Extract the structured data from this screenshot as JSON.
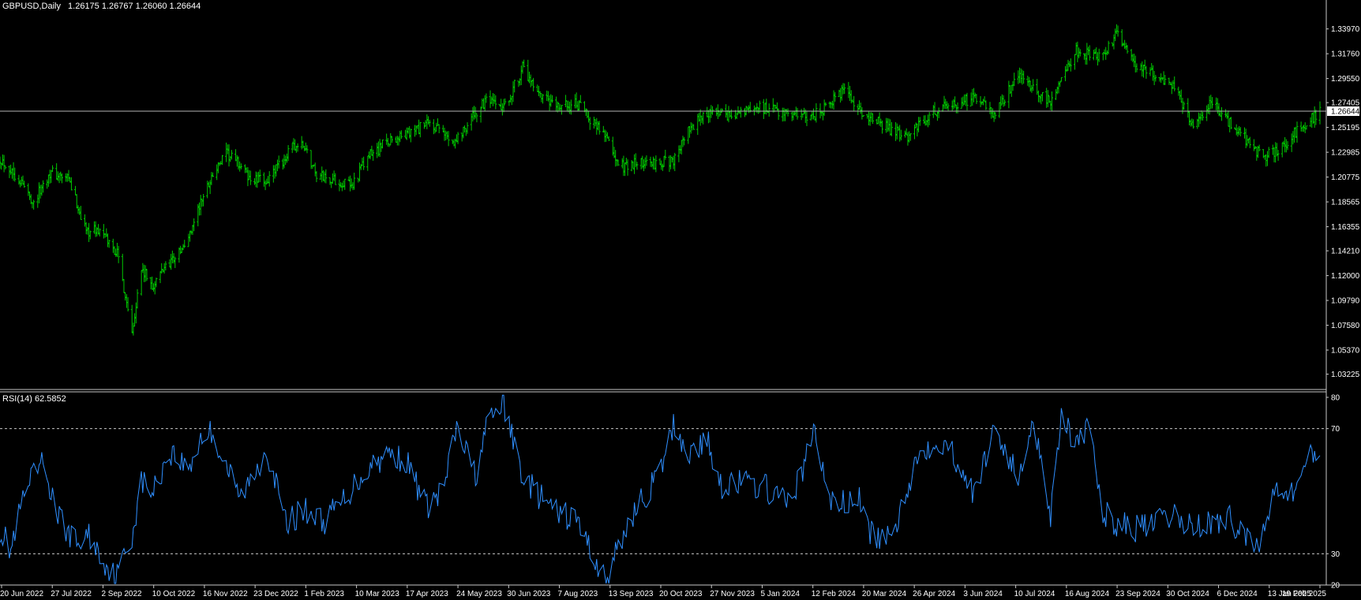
{
  "colors": {
    "background": "#000000",
    "text": "#ffffff",
    "axis": "#c8c8c8",
    "candle": "#00c800",
    "rsi": "#2f8fff",
    "level_line": "#c8c8c8",
    "current_price_bg": "#ffffff",
    "current_price_text": "#000000"
  },
  "chart_data": [
    {
      "type": "line",
      "render": "ohlc_bars",
      "symbol": "GBPUSD",
      "timeframe": "Daily",
      "title": "GBPUSD,Daily",
      "ohlc_text": "1.26175 1.26767 1.26060 1.26644",
      "last_ohlc": {
        "open": 1.26175,
        "high": 1.26767,
        "low": 1.2606,
        "close": 1.26644
      },
      "current_price": 1.26644,
      "current_price_label": "1.26644",
      "ylim": [
        1.02,
        1.35
      ],
      "y_ticks": [
        "1.33970",
        "1.31760",
        "1.29550",
        "1.27405",
        "1.25195",
        "1.22985",
        "1.20775",
        "1.18565",
        "1.16355",
        "1.14210",
        "1.12000",
        "1.09790",
        "1.07580",
        "1.05370",
        "1.03225"
      ],
      "xlim": [
        "2022-06-20",
        "2025-02-24"
      ],
      "series": [
        {
          "x": [
            "2022-06-20",
            "2022-07-05",
            "2022-07-15",
            "2022-07-27",
            "2022-08-10",
            "2022-08-23",
            "2022-09-02",
            "2022-09-15",
            "2022-09-26",
            "2022-10-03",
            "2022-10-12",
            "2022-10-20",
            "2022-11-04",
            "2022-11-16",
            "2022-11-24",
            "2022-12-05",
            "2022-12-14",
            "2022-12-23",
            "2023-01-05",
            "2023-01-24",
            "2023-02-01",
            "2023-02-10",
            "2023-03-08",
            "2023-03-20",
            "2023-04-04",
            "2023-04-17",
            "2023-05-04",
            "2023-05-24",
            "2023-06-07",
            "2023-06-16",
            "2023-06-29",
            "2023-07-13",
            "2023-07-24",
            "2023-08-07",
            "2023-08-22",
            "2023-09-13",
            "2023-09-22",
            "2023-10-03",
            "2023-10-20",
            "2023-11-01",
            "2023-11-14",
            "2023-11-27",
            "2023-12-13",
            "2024-01-05",
            "2024-01-26",
            "2024-02-12",
            "2024-03-08",
            "2024-03-20",
            "2024-04-12",
            "2024-04-22",
            "2024-05-03",
            "2024-05-15",
            "2024-06-03",
            "2024-06-12",
            "2024-06-27",
            "2024-07-17",
            "2024-07-26",
            "2024-08-08",
            "2024-08-16",
            "2024-08-27",
            "2024-09-11",
            "2024-09-23",
            "2024-09-26",
            "2024-10-08",
            "2024-10-23",
            "2024-10-30",
            "2024-11-06",
            "2024-11-22",
            "2024-12-06",
            "2024-12-19",
            "2025-01-13",
            "2025-01-21",
            "2025-02-04",
            "2025-02-19",
            "2025-02-24"
          ],
          "values": [
            1.225,
            1.205,
            1.185,
            1.212,
            1.205,
            1.16,
            1.16,
            1.14,
            1.072,
            1.125,
            1.11,
            1.128,
            1.145,
            1.185,
            1.208,
            1.228,
            1.22,
            1.205,
            1.205,
            1.235,
            1.235,
            1.21,
            1.2,
            1.225,
            1.24,
            1.245,
            1.255,
            1.24,
            1.263,
            1.275,
            1.268,
            1.305,
            1.28,
            1.27,
            1.273,
            1.245,
            1.217,
            1.22,
            1.22,
            1.222,
            1.25,
            1.265,
            1.262,
            1.27,
            1.265,
            1.26,
            1.284,
            1.265,
            1.25,
            1.243,
            1.255,
            1.267,
            1.275,
            1.278,
            1.265,
            1.3,
            1.285,
            1.275,
            1.295,
            1.32,
            1.315,
            1.325,
            1.338,
            1.31,
            1.3,
            1.295,
            1.29,
            1.255,
            1.275,
            1.256,
            1.225,
            1.23,
            1.245,
            1.26,
            1.2664
          ]
        }
      ]
    },
    {
      "type": "line",
      "title": "RSI(14) 62.5852",
      "indicator": "RSI(14)",
      "value": 62.5852,
      "value_label": "62.5852",
      "ylim": [
        20,
        81
      ],
      "y_ticks": [
        "80",
        "70",
        "30",
        "20"
      ],
      "levels": [
        70,
        30
      ],
      "series": [
        {
          "x": [
            "2022-06-20",
            "2022-06-28",
            "2022-07-07",
            "2022-07-15",
            "2022-07-22",
            "2022-08-02",
            "2022-08-16",
            "2022-08-25",
            "2022-09-02",
            "2022-09-14",
            "2022-09-26",
            "2022-10-03",
            "2022-10-12",
            "2022-10-24",
            "2022-11-07",
            "2022-11-16",
            "2022-11-24",
            "2022-12-05",
            "2022-12-15",
            "2022-12-23",
            "2023-01-04",
            "2023-01-18",
            "2023-02-02",
            "2023-02-15",
            "2023-03-02",
            "2023-03-10",
            "2023-03-24",
            "2023-04-05",
            "2023-04-17",
            "2023-05-03",
            "2023-05-15",
            "2023-05-25",
            "2023-06-08",
            "2023-06-16",
            "2023-06-28",
            "2023-07-13",
            "2023-07-24",
            "2023-08-07",
            "2023-08-22",
            "2023-09-05",
            "2023-09-13",
            "2023-09-22",
            "2023-10-03",
            "2023-10-13",
            "2023-10-24",
            "2023-11-02",
            "2023-11-14",
            "2023-11-27",
            "2023-12-08",
            "2023-12-20",
            "2024-01-10",
            "2024-01-25",
            "2024-02-06",
            "2024-02-14",
            "2024-02-26",
            "2024-03-08",
            "2024-03-18",
            "2024-03-28",
            "2024-04-12",
            "2024-04-22",
            "2024-05-03",
            "2024-05-15",
            "2024-05-24",
            "2024-06-03",
            "2024-06-12",
            "2024-06-27",
            "2024-07-16",
            "2024-07-26",
            "2024-08-08",
            "2024-08-16",
            "2024-08-27",
            "2024-09-06",
            "2024-09-16",
            "2024-09-26",
            "2024-10-08",
            "2024-10-23",
            "2024-11-06",
            "2024-11-21",
            "2024-12-06",
            "2024-12-19",
            "2025-01-10",
            "2025-01-21",
            "2025-02-04",
            "2025-02-14",
            "2025-02-24"
          ],
          "values": [
            38,
            31,
            47,
            55,
            59,
            42,
            33,
            36,
            30,
            22,
            36,
            53,
            50,
            63,
            57,
            67,
            69,
            58,
            48,
            53,
            64,
            40,
            44,
            40,
            47,
            52,
            59,
            62,
            60,
            45,
            50,
            70,
            55,
            70,
            79,
            55,
            49,
            43,
            41,
            28,
            21,
            32,
            43,
            49,
            57,
            71,
            62,
            66,
            52,
            53,
            51,
            46,
            56,
            70,
            47,
            46,
            48,
            36,
            34,
            50,
            62,
            67,
            64,
            58,
            48,
            71,
            53,
            75,
            42,
            76,
            64,
            70,
            43,
            40,
            38,
            39,
            42,
            39,
            40,
            41,
            32,
            53,
            49,
            61,
            61
          ]
        }
      ]
    }
  ],
  "x_labels": [
    "20 Jun 2022",
    "27 Jul 2022",
    "2 Sep 2022",
    "10 Oct 2022",
    "16 Nov 2022",
    "23 Dec 2022",
    "1 Feb 2023",
    "10 Mar 2023",
    "17 Apr 2023",
    "24 May 2023",
    "30 Jun 2023",
    "7 Aug 2023",
    "13 Sep 2023",
    "20 Oct 2023",
    "27 Nov 2023",
    "5 Jan 2024",
    "12 Feb 2024",
    "20 Mar 2024",
    "26 Apr 2024",
    "3 Jun 2024",
    "10 Jul 2024",
    "16 Aug 2024",
    "23 Sep 2024",
    "30 Oct 2024",
    "6 Dec 2024",
    "13 Jan 2025",
    "19 Feb 2025"
  ]
}
